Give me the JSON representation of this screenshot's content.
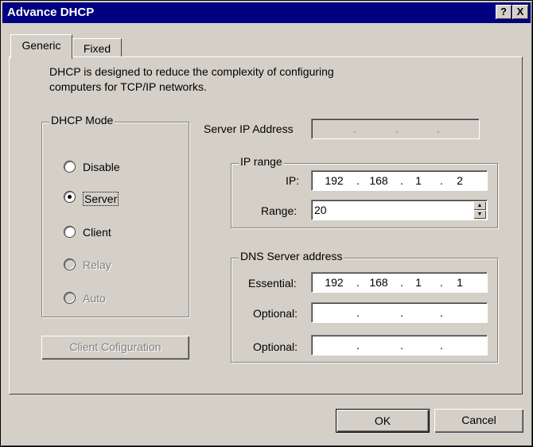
{
  "window": {
    "title": "Advance DHCP",
    "help_btn": "?",
    "close_btn": "X"
  },
  "tabs": [
    {
      "label": "Generic",
      "active": true
    },
    {
      "label": "Fixed",
      "active": false
    }
  ],
  "description": {
    "line1": "DHCP is designed to reduce the complexity of configuring",
    "line2": "computers for TCP/IP networks."
  },
  "dhcp_mode": {
    "legend": "DHCP Mode",
    "options": [
      {
        "label": "Disable",
        "selected": false,
        "enabled": true
      },
      {
        "label": "Server",
        "selected": true,
        "enabled": true
      },
      {
        "label": "Client",
        "selected": false,
        "enabled": true
      },
      {
        "label": "Relay",
        "selected": false,
        "enabled": false
      },
      {
        "label": "Auto",
        "selected": false,
        "enabled": false
      }
    ]
  },
  "client_config_button": "Client Cofiguration",
  "server_ip": {
    "label": "Server IP Address",
    "octets": [
      "",
      "",
      "",
      ""
    ]
  },
  "ip_range": {
    "legend": "IP range",
    "ip_label": "IP:",
    "octets": [
      "192",
      "168",
      "1",
      "2"
    ],
    "range_label": "Range:",
    "range_value": "20"
  },
  "dns": {
    "legend": "DNS Server address",
    "essential_label": "Essential:",
    "essential_octets": [
      "192",
      "168",
      "1",
      "1"
    ],
    "optional1_label": "Optional:",
    "optional1_octets": [
      "",
      "",
      "",
      ""
    ],
    "optional2_label": "Optional:",
    "optional2_octets": [
      "",
      "",
      "",
      ""
    ]
  },
  "buttons": {
    "ok": "OK",
    "cancel": "Cancel"
  }
}
